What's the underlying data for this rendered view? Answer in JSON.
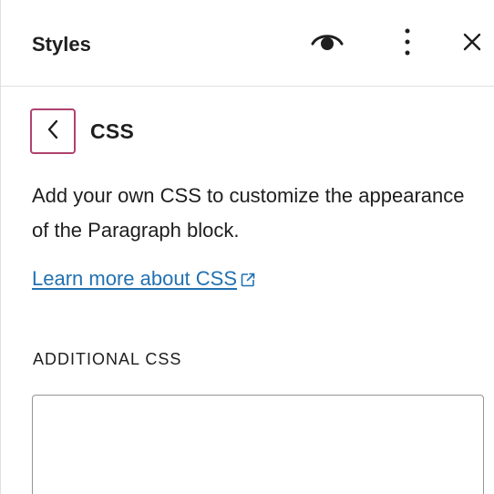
{
  "header": {
    "title": "Styles",
    "icons": {
      "preview": "eye-icon",
      "options": "more-vertical-icon",
      "close": "close-icon"
    }
  },
  "navigation": {
    "back_icon": "chevron-left-icon",
    "title": "CSS"
  },
  "content": {
    "description": "Add your own CSS to customize the appearance of the Paragraph block.",
    "link_text": "Learn more about CSS",
    "link_icon": "external-link-icon"
  },
  "additional_css": {
    "label": "ADDITIONAL CSS",
    "value": ""
  },
  "colors": {
    "text": "#1e1e1e",
    "link": "#2271b1",
    "back_button_border": "#b0426f",
    "divider": "#e0e0e0",
    "field_border": "#949494"
  }
}
